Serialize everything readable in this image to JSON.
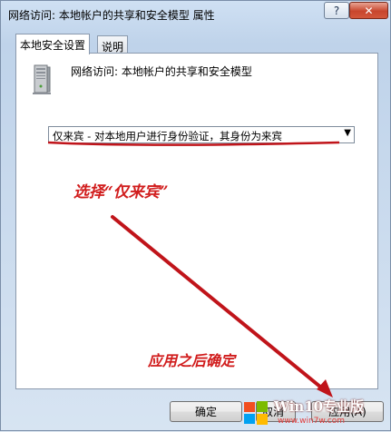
{
  "window": {
    "title": "网络访问: 本地帐户的共享和安全模型 属性",
    "help_glyph": "?",
    "close_glyph": "✕"
  },
  "tabs": [
    {
      "label": "本地安全设置",
      "active": true
    },
    {
      "label": "说明",
      "active": false
    }
  ],
  "policy": {
    "icon": "computer-icon",
    "name": "网络访问: 本地帐户的共享和安全模型"
  },
  "dropdown": {
    "selected": "仅来宾 - 对本地用户进行身份验证，其身份为来宾",
    "arrow_glyph": "▼"
  },
  "annotations": {
    "choose_text": "选择“仅来宾”",
    "apply_text": "应用之后确定",
    "color": "#d11d1d"
  },
  "buttons": {
    "ok_label": "确定",
    "cancel_label": "取消",
    "apply_label": "应用(A)"
  },
  "watermark": {
    "title": "Win10专业版",
    "site": "www.win7w.com"
  }
}
